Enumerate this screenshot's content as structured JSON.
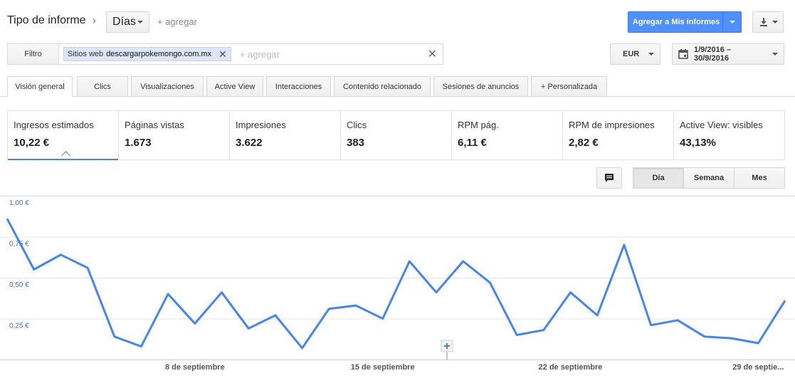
{
  "header": {
    "report_type_label": "Tipo de informe",
    "breadcrumb_sep": "›",
    "dimension": "Días",
    "add_link": "+ agregar",
    "add_to_reports": "Agregar a Mis informes",
    "download_icon": "download-icon"
  },
  "filter": {
    "label": "Filtro",
    "chip_prefix": "Sitios web",
    "chip_value": "descargarpokemongo.com.mx",
    "add_placeholder": "+ agregar",
    "clear": "✕",
    "chip_remove": "✕"
  },
  "currency": "EUR",
  "date_range": "1/9/2016 – 30/9/2016",
  "tabs": [
    {
      "label": "Visión general",
      "active": true
    },
    {
      "label": "Clics"
    },
    {
      "label": "Visualizaciones"
    },
    {
      "label": "Active View"
    },
    {
      "label": "Interacciones"
    },
    {
      "label": "Contenido relacionado"
    },
    {
      "label": "Sesiones de anuncios"
    },
    {
      "label": "+  Personalizada"
    }
  ],
  "metrics": [
    {
      "label": "Ingresos estimados",
      "value": "10,22 €",
      "active": true
    },
    {
      "label": "Páginas vistas",
      "value": "1.673"
    },
    {
      "label": "Impresiones",
      "value": "3.622"
    },
    {
      "label": "Clics",
      "value": "383"
    },
    {
      "label": "RPM pág.",
      "value": "6,11 €"
    },
    {
      "label": "RPM de impresiones",
      "value": "2,82 €"
    },
    {
      "label": "Active View: visibles",
      "value": "43,13%"
    }
  ],
  "period_buttons": [
    "Día",
    "Semana",
    "Mes"
  ],
  "period_active": "Día",
  "colors": {
    "accent": "#4285f4",
    "primary_button": "#4d90fe",
    "grid": "#e3e3e3",
    "axis_label": "#3d6fc4"
  },
  "chart_data": {
    "type": "line",
    "x": [
      "2016-09-01",
      "2016-09-02",
      "2016-09-03",
      "2016-09-04",
      "2016-09-05",
      "2016-09-06",
      "2016-09-07",
      "2016-09-08",
      "2016-09-09",
      "2016-09-10",
      "2016-09-11",
      "2016-09-12",
      "2016-09-13",
      "2016-09-14",
      "2016-09-15",
      "2016-09-16",
      "2016-09-17",
      "2016-09-18",
      "2016-09-19",
      "2016-09-20",
      "2016-09-21",
      "2016-09-22",
      "2016-09-23",
      "2016-09-24",
      "2016-09-25",
      "2016-09-26",
      "2016-09-27",
      "2016-09-28",
      "2016-09-29",
      "2016-09-30"
    ],
    "series": [
      {
        "values": [
          0.86,
          0.55,
          0.64,
          0.56,
          0.14,
          0.08,
          0.4,
          0.22,
          0.41,
          0.19,
          0.27,
          0.07,
          0.31,
          0.33,
          0.25,
          0.6,
          0.41,
          0.6,
          0.47,
          0.15,
          0.18,
          0.41,
          0.27,
          0.7,
          0.21,
          0.24,
          0.14,
          0.13,
          0.1,
          0.36
        ]
      }
    ],
    "y_ticks": [
      {
        "value": 1.0,
        "label": "1,00 €"
      },
      {
        "value": 0.75,
        "label": "0,75 €"
      },
      {
        "value": 0.5,
        "label": "0,50 €"
      },
      {
        "value": 0.25,
        "label": "0,25 €"
      }
    ],
    "ylim": [
      0,
      1.0
    ],
    "x_tick_labels": [
      {
        "index": 7,
        "label": "8 de septiembre"
      },
      {
        "index": 14,
        "label": "15 de septiembre"
      },
      {
        "index": 21,
        "label": "22 de septiembre"
      },
      {
        "index": 28,
        "label": "29 de septie..."
      }
    ],
    "grid": true,
    "title": "",
    "xlabel": "",
    "ylabel": ""
  }
}
